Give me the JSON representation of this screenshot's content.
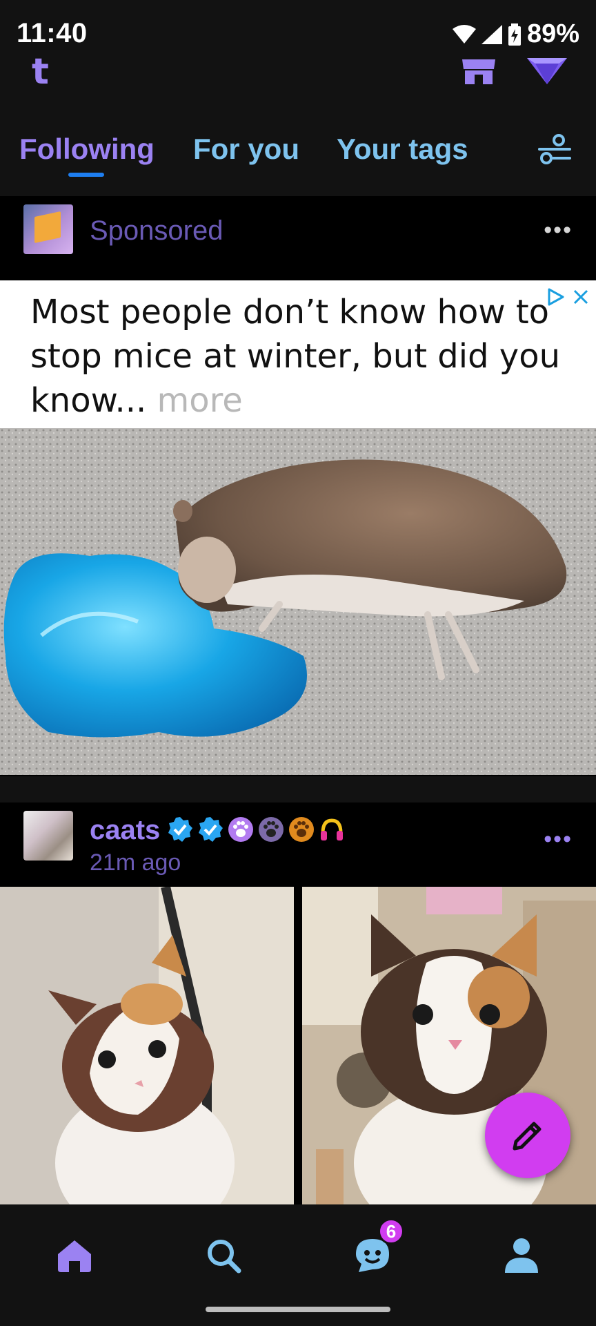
{
  "status_bar": {
    "time": "11:40",
    "battery": "89%"
  },
  "app": {
    "logo": "t"
  },
  "tabs": [
    {
      "label": "Following",
      "active": true
    },
    {
      "label": "For you",
      "active": false
    },
    {
      "label": "Your tags",
      "active": false
    }
  ],
  "sponsored_post": {
    "label": "Sponsored",
    "more": "•••",
    "ad_text": "Most people don’t know how to stop mice at winter, but did you know...",
    "ad_more": "more"
  },
  "post": {
    "blog_name": "caats",
    "time_ago": "21m ago",
    "more": "•••",
    "badges": [
      "verified-badge",
      "verified-badge",
      "paw-badge",
      "paw-badge",
      "paw-badge",
      "headphones-badge"
    ]
  },
  "bottom_nav": {
    "items": [
      "home-icon",
      "search-icon",
      "activity-icon",
      "account-icon"
    ],
    "activity_badge": "6"
  },
  "colors": {
    "accent_purple": "#9b82f2",
    "tab_blue": "#7ec3ee",
    "fab_pink": "#d13df0",
    "underline_blue": "#1e7ef0"
  }
}
